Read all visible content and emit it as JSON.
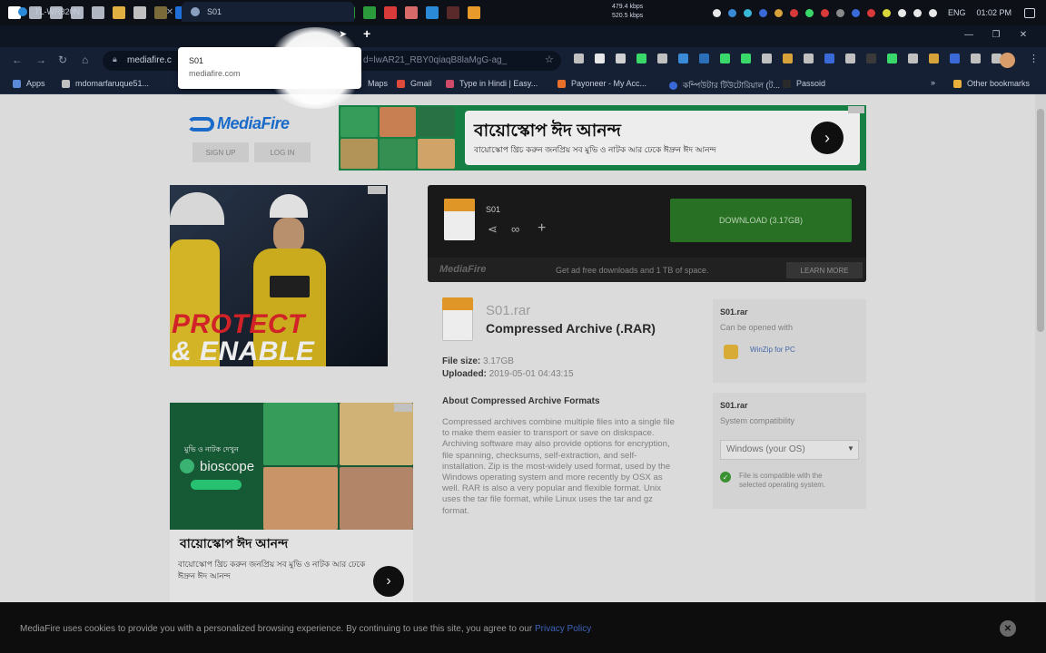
{
  "taskbar": {
    "net_up": "479.4 kbps",
    "net_down": "520.5 kbps",
    "lang": "ENG",
    "clock": "01:02 PM",
    "icon_colors": [
      "#ffffff",
      "#b0b6c2",
      "#b0b6c2",
      "#b0b6c2",
      "#b0b6c2",
      "#e0b040",
      "#c0c0c0",
      "#7a6a3a",
      "#1e6fd8",
      "#1e6fd8",
      "#1da1f2",
      "#111111",
      "#2a6fb8",
      "#e0502a",
      "#8a3ad8",
      "#6a3ad8",
      "#2a9a3a",
      "#2a9a3a",
      "#d83a3a",
      "#d86a6a",
      "#2a8ad8",
      "#5a2a2a",
      "#e89a2a"
    ],
    "tray_colors": [
      "#e8e8e8",
      "#3a8ad8",
      "#3ab8d8",
      "#3a6ad8",
      "#d8a23a",
      "#d83a3a",
      "#3ad86a",
      "#d83a3a",
      "#8a8a8a",
      "#3a6ad8",
      "#d83a3a",
      "#d8d83a",
      "#e8e8e8",
      "#e8e8e8",
      "#e8e8e8"
    ]
  },
  "tabs": [
    {
      "title": "TL-WR820N",
      "favicon_color": "#2a8ad8"
    },
    {
      "title": "S01",
      "favicon_color": "#8aa0c0"
    }
  ],
  "tab_popup": {
    "title": "S01",
    "domain": "mediafire.com"
  },
  "toolbar": {
    "url_visible": "mediafire.c",
    "url_tail": "d=lwAR21_RBY0qiaqB8laMgG-ag_",
    "ext_colors": [
      "#c0c0c0",
      "#e8e8e8",
      "#d0d0d0",
      "#3ad86a",
      "#c0c0c0",
      "#3a8ad8",
      "#2a6fb8",
      "#3ad86a",
      "#3ad86a",
      "#c0c0c0",
      "#d8a23a",
      "#c0c0c0",
      "#3a6ad8",
      "#c0c0c0",
      "#3a3a3a",
      "#3ad86a",
      "#c0c0c0",
      "#d8a23a",
      "#3a6ad8",
      "#c0c0c0",
      "#c0c0c0"
    ]
  },
  "bookmarks": {
    "items": [
      "Apps",
      "mdomarfaruque51...",
      "Maps",
      "Gmail",
      "Type in Hindi | Easy...",
      "Payoneer - My Acc...",
      "কম্পিউটার টিউটোরিয়াল (ট...",
      "Passoid"
    ],
    "more": "Other bookmarks"
  },
  "mediafire": {
    "logo": "MediaFire",
    "signup": "SIGN UP",
    "login": "LOG IN"
  },
  "ad_top": {
    "headline": "বায়োস্কোপ ঈদ আনন্দ",
    "sub": "বায়োস্কোপ খ্রিচ করুন জনপ্রিয় সব মুভি ও নাটক আর ঢেকে ঈদ্রুন ঈদ আনন্দ",
    "arrow": "›",
    "tile_colors": [
      "#3aa860",
      "#d88a5a",
      "#2a7a4a",
      "#c0a060",
      "#3a9a5a",
      "#e0b070"
    ]
  },
  "ad_left": {
    "line1": "PROTECT",
    "line2": "& ENABLE"
  },
  "file_card": {
    "name": "S01",
    "download": "DOWNLOAD (3.17GB)",
    "foot_logo": "MediaFire",
    "foot_text": "Get ad free downloads and 1 TB of space.",
    "learn_more": "LEARN MORE",
    "share_icon": "share-icon",
    "link_icon": "link-icon",
    "add_icon": "add-icon"
  },
  "file_details": {
    "filename": "S01.rar",
    "type": "Compressed Archive (.RAR)",
    "size_label": "File size:",
    "size": "3.17GB",
    "uploaded_label": "Uploaded:",
    "uploaded": "2019-05-01 04:43:15",
    "about_title": "About Compressed Archive Formats",
    "about_body": "Compressed archives combine multiple files into a single file to make them easier to transport or save on diskspace. Archiving software may also provide options for encryption, file spanning, checksums, self-extraction, and self-installation. Zip is the most-widely used format, used by the Windows operating system and more recently by OSX as well. RAR is also a very popular and flexible format. Unix uses the tar file format, while Linux uses the tar and gz format."
  },
  "side": {
    "p1_title": "S01.rar",
    "p1_sub": "Can be opened with",
    "winzip": "WinZip for PC",
    "p2_title": "S01.rar",
    "p2_sub": "System compatibility",
    "os": "Windows (your OS)",
    "compat": "File is compatible with the selected operating system."
  },
  "ad_left2": {
    "pill": "মুভি ও নাটক দেখুন",
    "brand": "bioscope",
    "headline": "বায়োস্কোপ ঈদ আনন্দ",
    "sub": "বায়োস্কোপ খ্রিচ করুন জনপ্রিয় সব মুভি ও নাটক আর ঢেকে ঈদ্রুন ঈদ আনন্দ",
    "arrow": "›",
    "tile_colors": [
      "#3aa860",
      "#e0c080",
      "#d8a070",
      "#c09070"
    ]
  },
  "cookie": {
    "text": "MediaFire uses cookies to provide you with a personalized browsing experience. By continuing to use this site, you agree to our",
    "link": "Privacy Policy",
    "close": "✕"
  },
  "colors": {
    "accent": "#1c74d9",
    "download_green": "#2c7a27",
    "file_orange": "#f0a22a"
  }
}
